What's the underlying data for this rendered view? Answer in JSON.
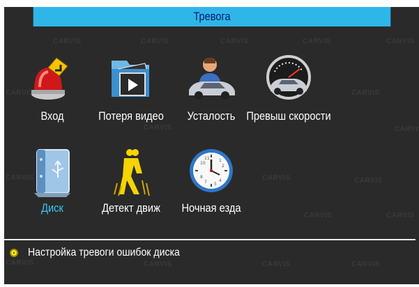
{
  "window": {
    "title": "Тревога"
  },
  "watermark": "CARVIS",
  "menu": {
    "items": [
      {
        "label": "Вход",
        "icon": "alarm-siren-icon",
        "selected": false
      },
      {
        "label": "Потеря видео",
        "icon": "video-folder-icon",
        "selected": false
      },
      {
        "label": "Усталость",
        "icon": "driver-car-icon",
        "selected": false
      },
      {
        "label": "Превыш скорости",
        "icon": "speedometer-car-icon",
        "selected": false
      },
      {
        "label": "Диск",
        "icon": "usb-disk-icon",
        "selected": true
      },
      {
        "label": "Детект движ",
        "icon": "motion-people-icon",
        "selected": false
      },
      {
        "label": "Ночная езда",
        "icon": "clock-icon",
        "selected": false
      }
    ]
  },
  "status": {
    "text": "Настройка тревоги ошибок диска",
    "icon": "bullet-icon"
  },
  "colors": {
    "title_bar": "#2fb6e9",
    "title_text": "#0a1a6a",
    "background": "#2a2a2a",
    "label": "#ffffff",
    "selected_label": "#35c8f2",
    "bullet": "#f2e21a"
  }
}
